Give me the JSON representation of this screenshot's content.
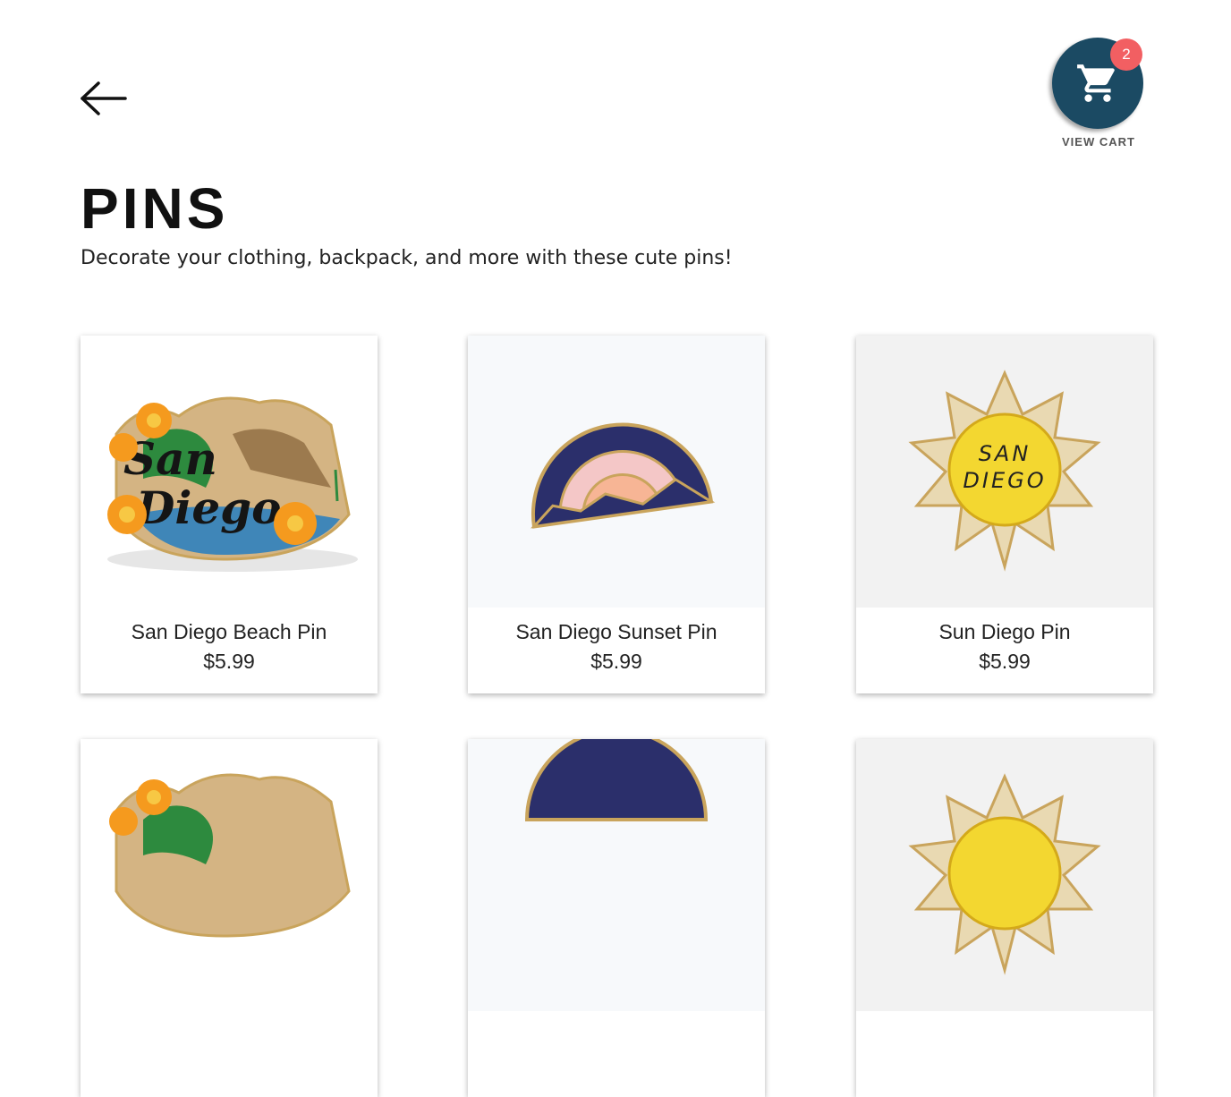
{
  "header": {
    "back_label": "Back"
  },
  "cart": {
    "count": "2",
    "label": "VIEW CART"
  },
  "page": {
    "title": "PINS",
    "subtitle": "Decorate your clothing, backpack, and more with these cute pins!"
  },
  "products": [
    {
      "name": "San Diego Beach Pin",
      "price": "$5.99",
      "image": "san-diego-beach-pin"
    },
    {
      "name": "San Diego Sunset Pin",
      "price": "$5.99",
      "image": "san-diego-sunset-pin"
    },
    {
      "name": "Sun Diego Pin",
      "price": "$5.99",
      "image": "sun-diego-pin"
    },
    {
      "name": "",
      "price": "",
      "image": "san-diego-beach-pin"
    },
    {
      "name": "",
      "price": "",
      "image": "san-diego-sunset-pin"
    },
    {
      "name": "",
      "price": "",
      "image": "sun-diego-pin"
    }
  ],
  "colors": {
    "cart_bg": "#1b4a63",
    "badge_bg": "#f25f62"
  }
}
